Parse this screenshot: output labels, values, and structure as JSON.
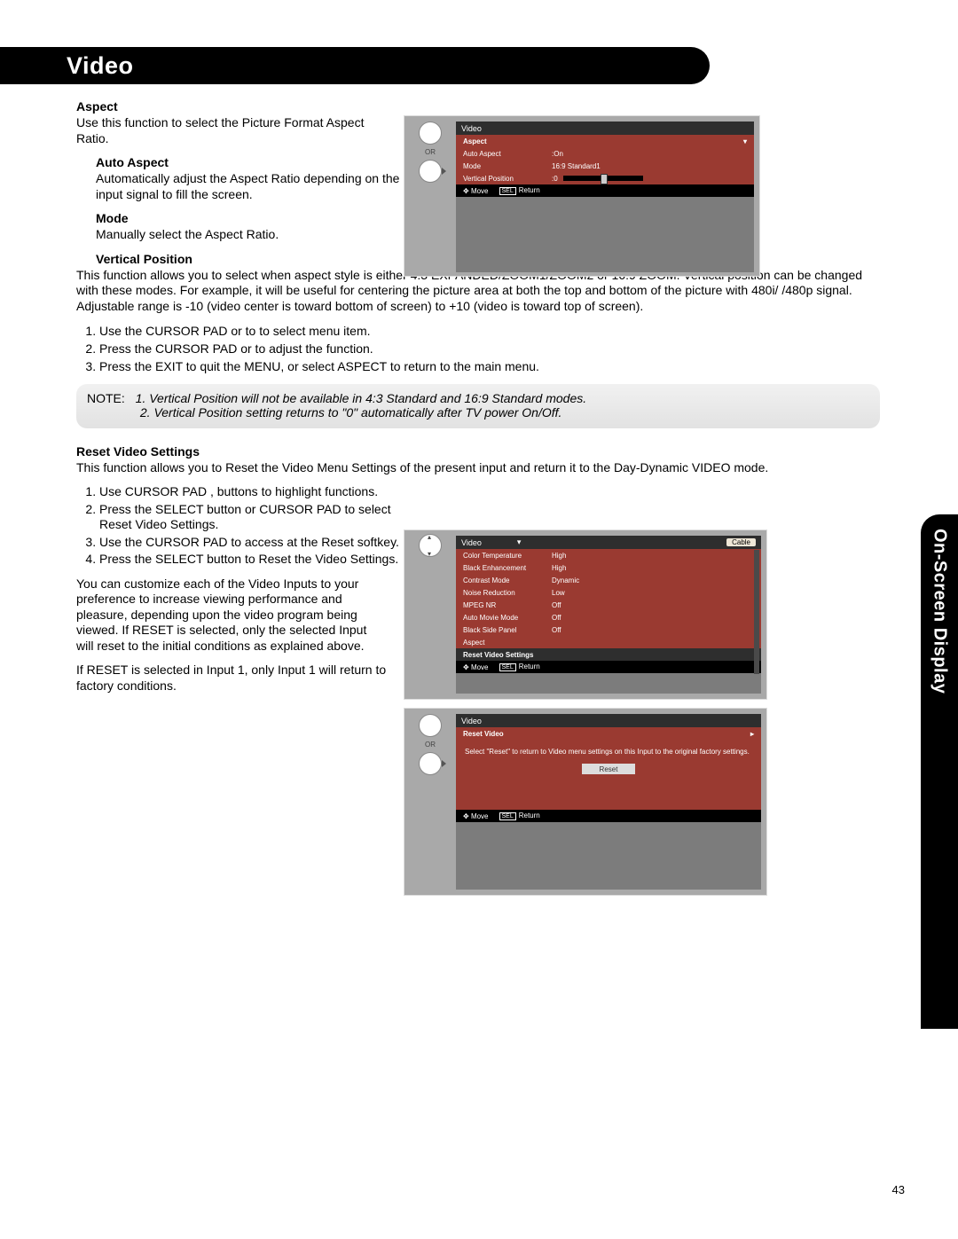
{
  "section_title": "Video",
  "side_tab": "On-Screen Display",
  "page_number": "43",
  "aspect": {
    "heading": "Aspect",
    "body": "Use this function to select the Picture Format Aspect Ratio.",
    "auto_heading": "Auto Aspect",
    "auto_body": "Automatically adjust the Aspect Ratio depending on the input signal to fill the screen.",
    "mode_heading": "Mode",
    "mode_body": "Manually select the Aspect Ratio.",
    "vpos_heading": "Vertical Position",
    "vpos_body": "This function allows you to select when aspect style is either 4:3 EXPANDED/ZOOM1/ZOOM2 or 16:9 ZOOM.  Vertical position can be changed with these modes.  For example, it will be useful for centering the picture area at both the top and bottom of the picture with 480i/ /480p signal.  Adjustable range is -10 (video center is toward bottom of screen) to +10 (video is toward top of screen).",
    "steps": [
      "Use the CURSOR PAD      or      to to select menu item.",
      "Press the CURSOR PAD      or      to adjust the function.",
      "Press the EXIT to quit the MENU, or select ASPECT to return to the main menu."
    ],
    "note_lead": "NOTE:",
    "note_1": "1. Vertical Position will not be available in 4:3 Standard and 16:9 Standard modes.",
    "note_2": "2. Vertical Position setting returns to \"0\" automatically after TV power On/Off."
  },
  "reset": {
    "heading": "Reset Video Settings",
    "intro": "This function allows you to Reset the Video Menu Settings of the present input and return it to the Day-Dynamic VIDEO mode.",
    "steps": [
      "Use CURSOR PAD    ,    buttons to highlight functions.",
      "Press the SELECT button or CURSOR PAD     to select Reset Video Settings.",
      "Use the CURSOR PAD     to access at the Reset softkey.",
      "Press the SELECT button to Reset the Video Settings."
    ],
    "para1": "You can customize each of the Video Inputs to your preference to increase viewing performance and pleasure, depending upon the video program being viewed. If RESET is selected, only the selected Input will reset to the initial conditions as explained above.",
    "para2": "If RESET is selected in Input 1, only Input 1 will return to factory conditions."
  },
  "osd1": {
    "or": "OR",
    "title": "Video",
    "menu": "Aspect",
    "rows": [
      {
        "k": "Auto Aspect",
        "sep": ":",
        "v": "On"
      },
      {
        "k": "Mode",
        "sep": "",
        "v": "16:9  Standard1"
      },
      {
        "k": "Vertical Position",
        "sep": ":",
        "v": "0"
      }
    ],
    "hint_move": "Move",
    "hint_sel": "SEL",
    "hint_return": "Return"
  },
  "osd2": {
    "title": "Video",
    "cable": "Cable",
    "rows": [
      {
        "k": "Color Temperature",
        "v": "High"
      },
      {
        "k": "Black Enhancement",
        "v": "High"
      },
      {
        "k": "Contrast Mode",
        "v": "Dynamic"
      },
      {
        "k": "Noise Reduction",
        "v": "Low"
      },
      {
        "k": "MPEG NR",
        "v": "Off"
      },
      {
        "k": "Auto Movie Mode",
        "v": "Off"
      },
      {
        "k": "Black Side Panel",
        "v": "Off"
      },
      {
        "k": "Aspect",
        "v": ""
      }
    ],
    "reset_label": "Reset Video Settings",
    "hint_move": "Move",
    "hint_sel": "SEL",
    "hint_return": "Return"
  },
  "osd3": {
    "or": "OR",
    "title": "Video",
    "menu": "Reset Video",
    "msg": "Select \"Reset\" to return to Video menu settings on this Input to the original factory settings.",
    "reset_btn": "Reset",
    "hint_move": "Move",
    "hint_sel": "SEL",
    "hint_return": "Return"
  }
}
